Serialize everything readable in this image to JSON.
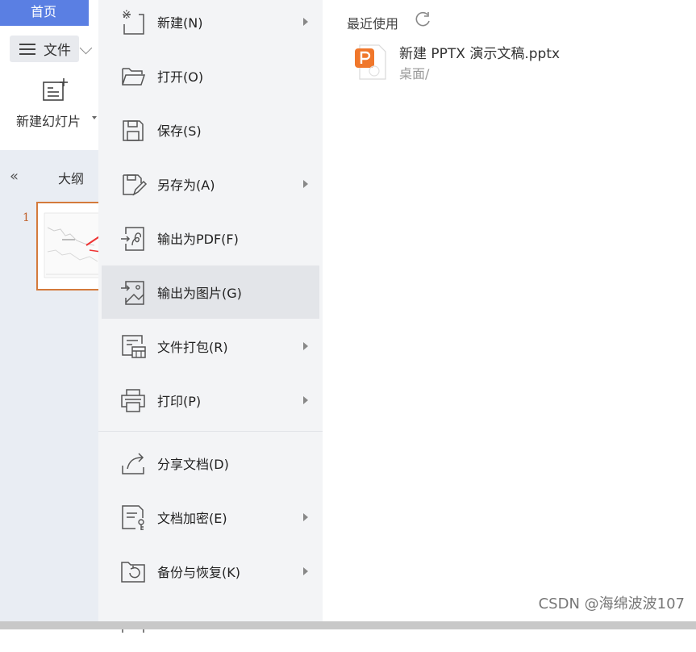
{
  "ribbon": {
    "home_tab": "首页",
    "file_menu": "文件",
    "new_slide": "新建幻灯片"
  },
  "outline": {
    "label": "大纲",
    "slide_number": "1"
  },
  "menu": {
    "items": [
      {
        "label": "新建(N)",
        "icon": "new-file-icon",
        "has_submenu": true
      },
      {
        "label": "打开(O)",
        "icon": "folder-open-icon",
        "has_submenu": false
      },
      {
        "label": "保存(S)",
        "icon": "save-icon",
        "has_submenu": false
      },
      {
        "label": "另存为(A)",
        "icon": "save-as-icon",
        "has_submenu": true
      },
      {
        "label": "输出为PDF(F)",
        "icon": "export-pdf-icon",
        "has_submenu": false
      },
      {
        "label": "输出为图片(G)",
        "icon": "export-image-icon",
        "has_submenu": false,
        "active": true
      },
      {
        "label": "文件打包(R)",
        "icon": "package-icon",
        "has_submenu": true
      },
      {
        "label": "打印(P)",
        "icon": "printer-icon",
        "has_submenu": true
      },
      {
        "label": "分享文档(D)",
        "icon": "share-icon",
        "has_submenu": false
      },
      {
        "label": "文档加密(E)",
        "icon": "encrypt-icon",
        "has_submenu": true
      },
      {
        "label": "备份与恢复(K)",
        "icon": "backup-icon",
        "has_submenu": true
      }
    ]
  },
  "recent": {
    "title": "最近使用",
    "files": [
      {
        "name": "新建 PPTX 演示文稿.pptx",
        "path": "桌面/"
      }
    ]
  },
  "watermark": "CSDN @海绵波波107",
  "colors": {
    "home_tab": "#5a7fe3",
    "pptx_icon": "#f0772b",
    "thumb_border": "#d47a3b"
  }
}
